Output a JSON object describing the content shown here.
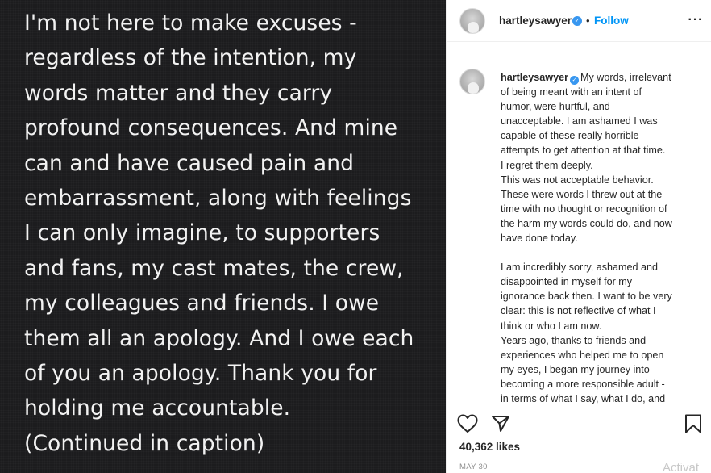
{
  "post": {
    "image_text_lines": [
      "I'm not here to make excuses -",
      "regardless of the intention, my",
      "words matter and they carry",
      "profound consequences. And mine",
      "can and have caused pain and",
      "embarrassment, along with feelings",
      "I can only imagine, to supporters",
      "and fans, my cast mates, the crew,",
      "my colleagues and friends. I owe",
      "them all an apology. And I owe each",
      "of you an apology. Thank you for",
      "holding me accountable.",
      "(Continued in caption)"
    ]
  },
  "header": {
    "username": "hartleysawyer",
    "separator": "•",
    "follow_label": "Follow",
    "more_icon": "ellipsis-icon"
  },
  "caption": {
    "username": "hartleysawyer",
    "first_line": "My words, irrelevant",
    "lines": [
      "of being meant with an intent of",
      "humor, were hurtful, and",
      "unacceptable. I am ashamed I was",
      "capable of these really horrible",
      "attempts to get attention at that time.",
      "I regret them deeply.",
      "This was not acceptable behavior.",
      "These were words I threw out at the",
      "time with no thought or recognition of",
      "the harm my words could do, and now",
      "have done today."
    ],
    "lines2": [
      "I am incredibly sorry, ashamed and",
      "disappointed in myself for my",
      "ignorance back then. I want to be very",
      "clear: this is not reflective of what I",
      "think or who I am now.",
      "Years ago, thanks to friends and",
      "experiences who helped me to open",
      "my eyes, I began my journey into",
      "becoming a more responsible adult -",
      "in terms of what I say, what I do, and"
    ]
  },
  "actions": {
    "likes": "40,362 likes",
    "date": "MAY 30",
    "watermark": "Activat"
  },
  "colors": {
    "accent": "#0095f6",
    "verified": "#3897f0",
    "image_background": "#1c1c1e"
  }
}
